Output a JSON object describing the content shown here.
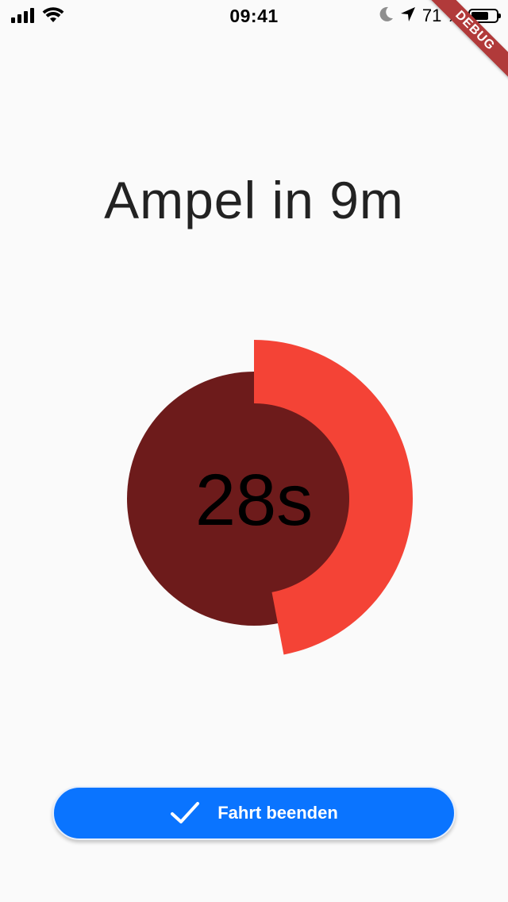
{
  "status_bar": {
    "time": "09:41",
    "battery_percent": "71 %",
    "battery_level": 0.71,
    "icons": [
      "cellular-signal-icon",
      "wifi-icon",
      "moon-icon",
      "location-arrow-icon",
      "battery-icon"
    ]
  },
  "debug_banner": "DEBUG",
  "headline": "Ampel in 9m",
  "countdown": {
    "label": "28s",
    "progress_fraction": 0.47,
    "colors": {
      "remaining_arc": "#f44336",
      "inner_disc": "#6d1b1b"
    }
  },
  "finish_button": {
    "label": "Fahrt beenden",
    "icon": "check-icon",
    "color": "#0a74ff"
  }
}
